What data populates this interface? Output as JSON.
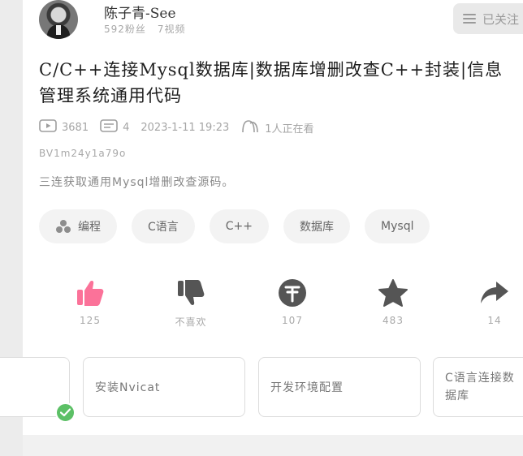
{
  "author": {
    "name": "陈子青-See",
    "fans": "592粉丝",
    "videos": "7视频",
    "follow_label": "已关注"
  },
  "video": {
    "title": "C/C++连接Mysql数据库|数据库增删改查C++封装|信息管理系统通用代码",
    "plays": "3681",
    "danmaku": "4",
    "datetime": "2023-1-11 19:23",
    "watching": "1人正在看",
    "bvid": "BV1m24y1a79o",
    "description": "三连获取通用Mysql增删改查源码。"
  },
  "tags": [
    "编程",
    "C语言",
    "C++",
    "数据库",
    "Mysql"
  ],
  "actions": {
    "like": "125",
    "dislike": "不喜欢",
    "coin": "107",
    "favorite": "483",
    "share": "14"
  },
  "episodes": [
    "安装Nvicat",
    "开发环境配置",
    "C语言连接数据库"
  ],
  "colors": {
    "like": "#fb7299",
    "icon": "#555555",
    "check": "#5cc066"
  }
}
